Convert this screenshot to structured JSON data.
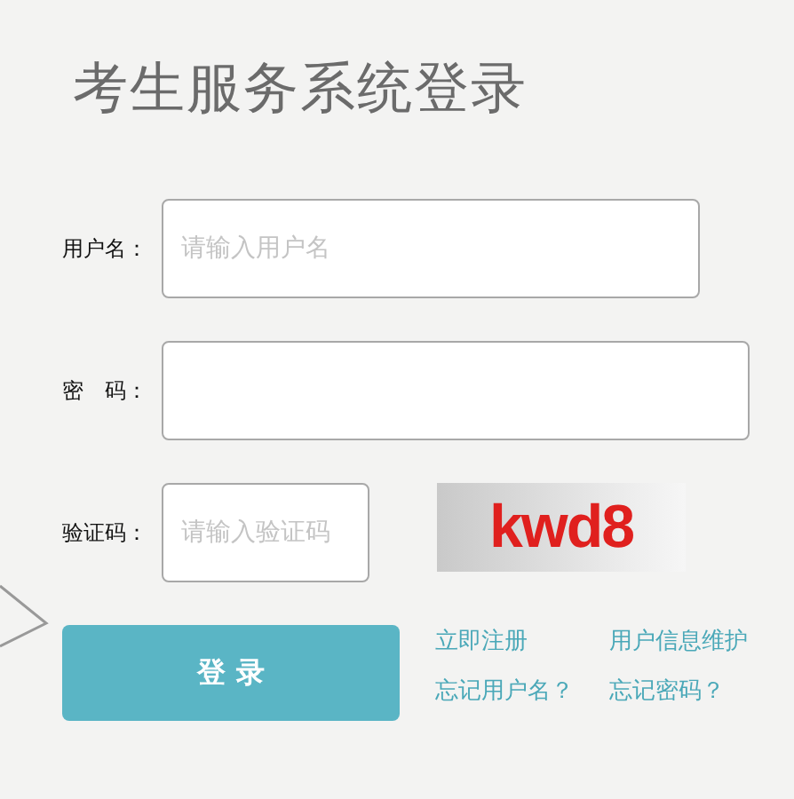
{
  "title": "考生服务系统登录",
  "fields": [
    {
      "kind": "text",
      "label": "用户名：",
      "placeholder": "请输入用户名"
    },
    {
      "kind": "password",
      "label": "密　码："
    }
  ],
  "captcha": {
    "label": "验证码：",
    "placeholder": "请输入验证码",
    "code": "kwd8"
  },
  "login_button": "登 录",
  "links": [
    "立即注册",
    "用户信息维护",
    "忘记用户名？",
    "忘记密码？"
  ]
}
